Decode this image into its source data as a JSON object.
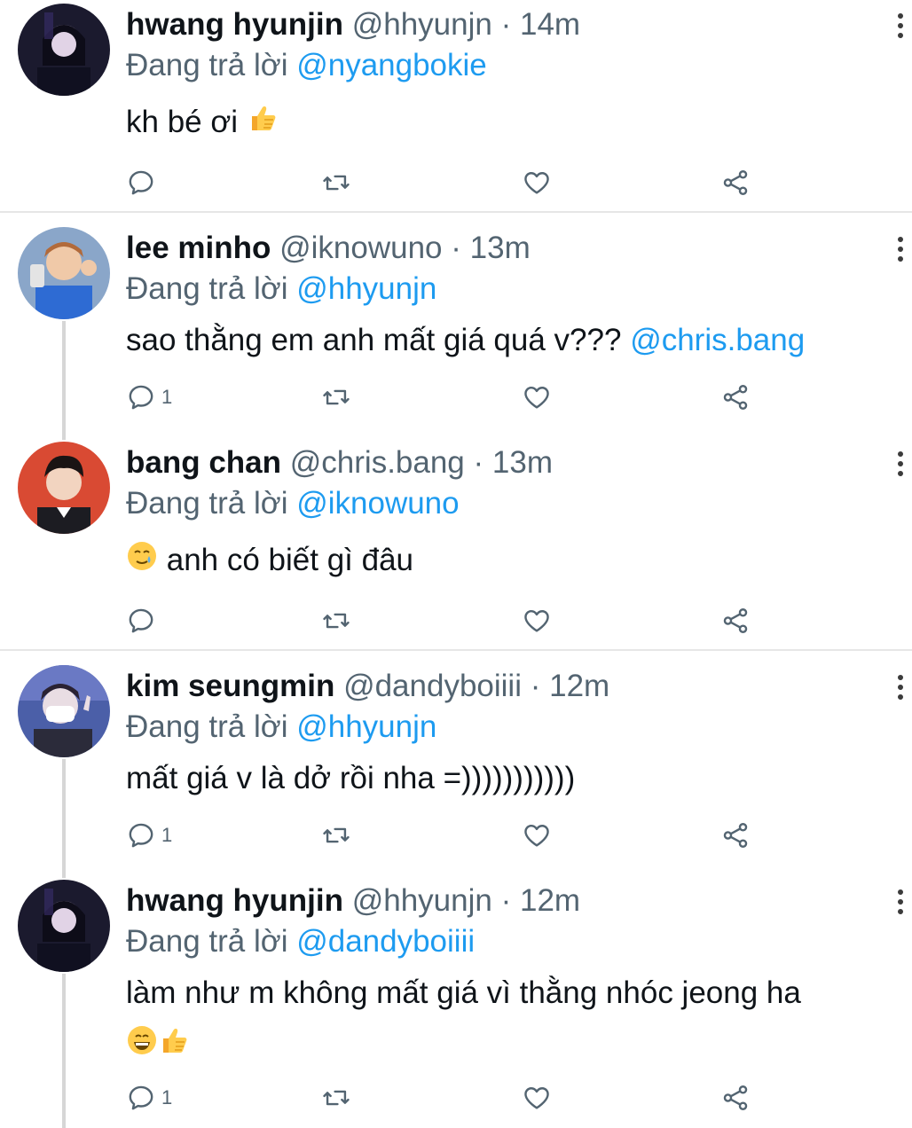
{
  "tweets": [
    {
      "name": "hwang hyunjin",
      "handle": "@hhyunjn",
      "time": "14m",
      "reply_prefix": "Đang trả lời",
      "reply_to": "@nyangbokie",
      "text": "kh bé ơi",
      "reply_count": ""
    },
    {
      "name": "lee minho",
      "handle": "@iknowuno",
      "time": "13m",
      "reply_prefix": "Đang trả lời",
      "reply_to": "@hhyunjn",
      "text": "sao thằng em anh mất giá quá v???",
      "text_mention": "@chris.bang",
      "reply_count": "1"
    },
    {
      "name": "bang chan",
      "handle": "@chris.bang",
      "time": "13m",
      "reply_prefix": "Đang trả lời",
      "reply_to": "@iknowuno",
      "text": "anh có biết gì đâu",
      "reply_count": ""
    },
    {
      "name": "kim seungmin",
      "handle": "@dandyboiiii",
      "time": "12m",
      "reply_prefix": "Đang trả lời",
      "reply_to": "@hhyunjn",
      "text": "mất giá v là dở rồi nha =)))))))))))",
      "reply_count": "1"
    },
    {
      "name": "hwang hyunjin",
      "handle": "@hhyunjn",
      "time": "12m",
      "reply_prefix": "Đang trả lời",
      "reply_to": "@dandyboiiii",
      "text": "làm như m không mất giá vì thằng nhóc jeong ha",
      "reply_count": "1"
    }
  ],
  "separator": "·",
  "icons": {
    "reply": "reply-icon",
    "retweet": "retweet-icon",
    "like": "heart-icon",
    "share": "share-icon",
    "more": "more-options-icon"
  },
  "colors": {
    "mention": "#1d9bf0",
    "secondary_text": "#536471",
    "primary_text": "#0f1419"
  }
}
